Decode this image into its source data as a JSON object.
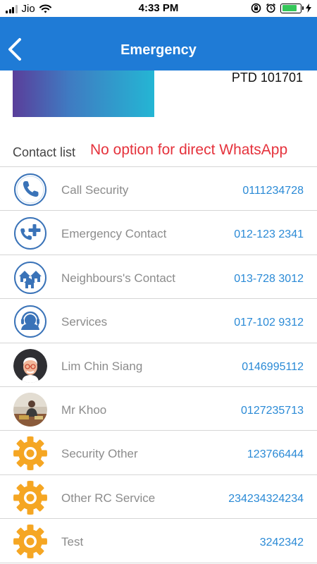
{
  "status_bar": {
    "carrier": "Jio",
    "time": "4:33 PM",
    "battery_level": 0.8,
    "signal_bars": 3
  },
  "header": {
    "title": "Emergency",
    "back_icon": "chevron-left-icon"
  },
  "colors": {
    "header": "#1f7bd6",
    "phone_text": "#2a8ad6",
    "annotation": "#e5323c",
    "gear_orange": "#f5a623"
  },
  "unit": {
    "code": "PTD 101701"
  },
  "contacts_section": {
    "title": "Contact list",
    "annotation": "No option for direct WhatsApp",
    "contacts": [
      {
        "name": "Call Security",
        "phone": "0111234728",
        "icon": "phone-icon"
      },
      {
        "name": "Emergency Contact",
        "phone": "012-123 2341",
        "icon": "phone-plus-icon"
      },
      {
        "name": "Neighbours's Contact",
        "phone": "013-728 3012",
        "icon": "houses-icon"
      },
      {
        "name": "Services",
        "phone": "017-102 9312",
        "icon": "headset-icon"
      },
      {
        "name": "Lim Chin Siang",
        "phone": "0146995112",
        "icon": "avatar-man-glasses"
      },
      {
        "name": "Mr Khoo",
        "phone": "0127235713",
        "icon": "avatar-photo"
      },
      {
        "name": "Security Other",
        "phone": "123766444",
        "icon": "gear-icon"
      },
      {
        "name": "Other RC Service",
        "phone": "234234324234",
        "icon": "gear-icon"
      },
      {
        "name": "Test",
        "phone": "3242342",
        "icon": "gear-icon"
      }
    ]
  }
}
